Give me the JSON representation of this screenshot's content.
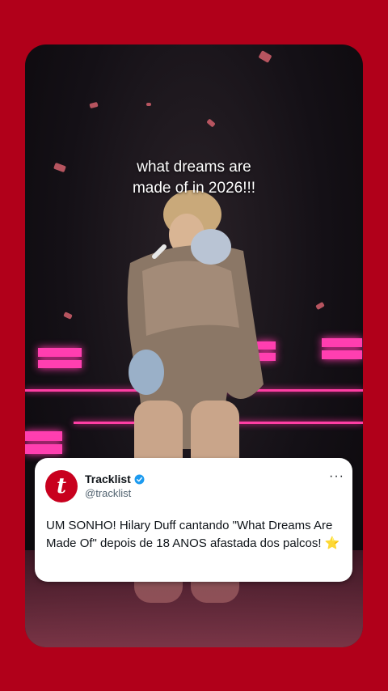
{
  "video": {
    "caption_line1": "what dreams are",
    "caption_line2": "made of in 2026!!!"
  },
  "post": {
    "avatar_letter": "t",
    "name": "Tracklist",
    "handle": "@tracklist",
    "more_icon": "···",
    "text": "UM SONHO! Hilary Duff cantando \"What Dreams Are Made Of\" depois de 18 ANOS afastada dos palcos! ⭐"
  },
  "colors": {
    "background": "#b1001a",
    "brand": "#c8001e",
    "verified": "#1d9bf0",
    "stage_light": "#ff3fb0"
  }
}
